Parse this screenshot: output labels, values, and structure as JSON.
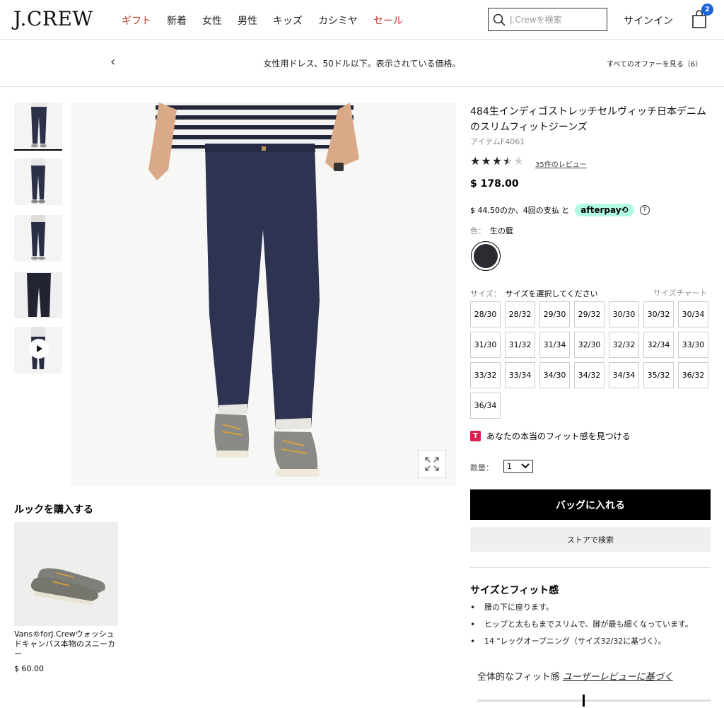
{
  "header": {
    "logo": "J.CREW",
    "nav": [
      {
        "label": "ギフト",
        "highlight": true
      },
      {
        "label": "新着",
        "highlight": false
      },
      {
        "label": "女性",
        "highlight": false
      },
      {
        "label": "男性",
        "highlight": false
      },
      {
        "label": "キッズ",
        "highlight": false
      },
      {
        "label": "カシミヤ",
        "highlight": false
      },
      {
        "label": "セール",
        "highlight": true
      }
    ],
    "search_placeholder": "J.Crewを検索",
    "signin": "サインイン",
    "bag_count": "2"
  },
  "promo": {
    "prev": "‹",
    "text": "女性用ドレス、50ドル以下。表示されている価格。",
    "view_all": "すべてのオファーを見る（6）"
  },
  "product": {
    "title": "484生インディゴストレッチセルヴィッチ日本デニムのスリムフィットジーンズ",
    "item": "アイテムF4061",
    "rating": 3.5,
    "reviews": "35件のレビュー",
    "price": "$ 178.00",
    "installment": "$ 44.50のか、4回の支払 と",
    "afterpay": "afterpay⟲",
    "color_key": "色：",
    "color_value": "生の藍",
    "size_key": "サイズ：",
    "size_value": "サイズを選択してください",
    "size_chart": "サイズチャート",
    "sizes": [
      "28/30",
      "28/32",
      "29/30",
      "29/32",
      "30/30",
      "30/32",
      "30/34",
      "31/30",
      "31/32",
      "31/34",
      "32/30",
      "32/32",
      "32/34",
      "33/30",
      "33/32",
      "33/34",
      "34/30",
      "34/32",
      "34/34",
      "35/32",
      "36/32",
      "36/34"
    ],
    "fit_finder": "あなたの本当のフィット感を見つける",
    "fit_icon": "T",
    "qty_label": "数量：",
    "qty_value": "1",
    "add_to_bag": "バッグに入れる",
    "find_in_store": "ストアで検索"
  },
  "fit": {
    "title": "サイズとフィット感",
    "items": [
      "腰の下に座ります。",
      "ヒップと太ももまでスリムで、脚が最も細くなっています。",
      "14 \"レッグオープニング（サイズ32/32に基づく）。"
    ],
    "overall_prefix": "全体的なフィット感",
    "overall_link": "ユーザーレビューに基づく",
    "slider_position": 0.45
  },
  "look": {
    "title": "ルックを購入する",
    "name": "Vans®forJ.Crewウォッシュドキャンバス本物のスニーカー",
    "price": "$ 60.00"
  },
  "colors": {
    "sale_red": "#c0392b",
    "bag_badge": "#1a63d6",
    "afterpay_mint": "#b2fce4",
    "fit_icon": "#d6204e"
  }
}
